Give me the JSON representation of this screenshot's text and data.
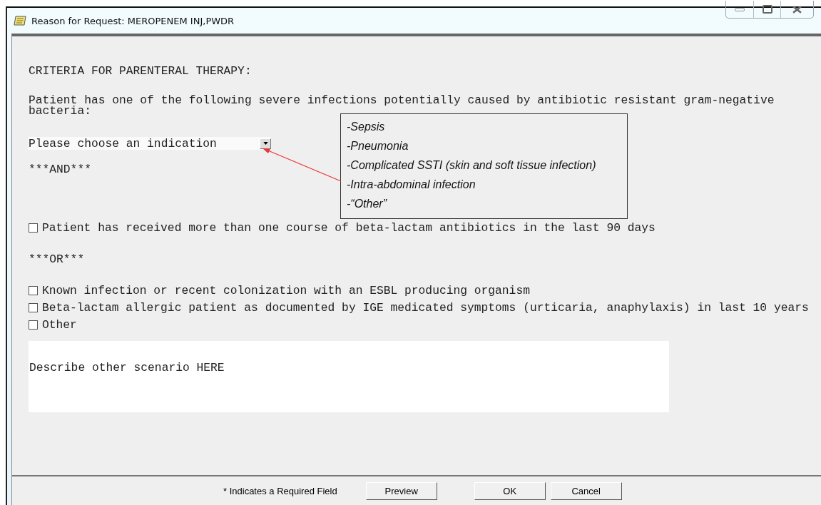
{
  "window": {
    "title": "Reason for Request: MEROPENEM INJ,PWDR"
  },
  "form": {
    "items": [
      {
        "kind": "heading",
        "text": "CRITERIA FOR PARENTERAL THERAPY:"
      },
      {
        "kind": "text",
        "text": "Patient has one of the following severe infections potentially caused by antibiotic resistant gram-negative bacteria:"
      },
      {
        "kind": "dropdown",
        "value": "Please choose an indication"
      },
      {
        "kind": "separator",
        "text": "***AND***"
      },
      {
        "kind": "checkbox",
        "label": "Patient has received more than one course of beta-lactam antibiotics in the last 90 days",
        "checked": false
      },
      {
        "kind": "separator",
        "text": "***OR***"
      },
      {
        "kind": "checkbox",
        "label": "Known infection or recent colonization with an ESBL producing organism",
        "checked": false
      },
      {
        "kind": "checkbox",
        "label": "Beta-lactam allergic patient as documented by IGE medicated symptoms (urticaria, anaphylaxis) in last 10 years",
        "checked": false
      },
      {
        "kind": "checkbox",
        "label": "Other",
        "checked": false
      },
      {
        "kind": "textarea",
        "value": "Describe other scenario HERE"
      }
    ]
  },
  "callout": {
    "items": [
      "-Sepsis",
      "-Pneumonia",
      "-Complicated SSTI (skin and soft tissue infection)",
      "-Intra-abdominal infection",
      "-“Other”"
    ]
  },
  "footer": {
    "note": "* Indicates a Required Field",
    "buttons": [
      "Preview",
      "OK",
      "Cancel"
    ]
  }
}
